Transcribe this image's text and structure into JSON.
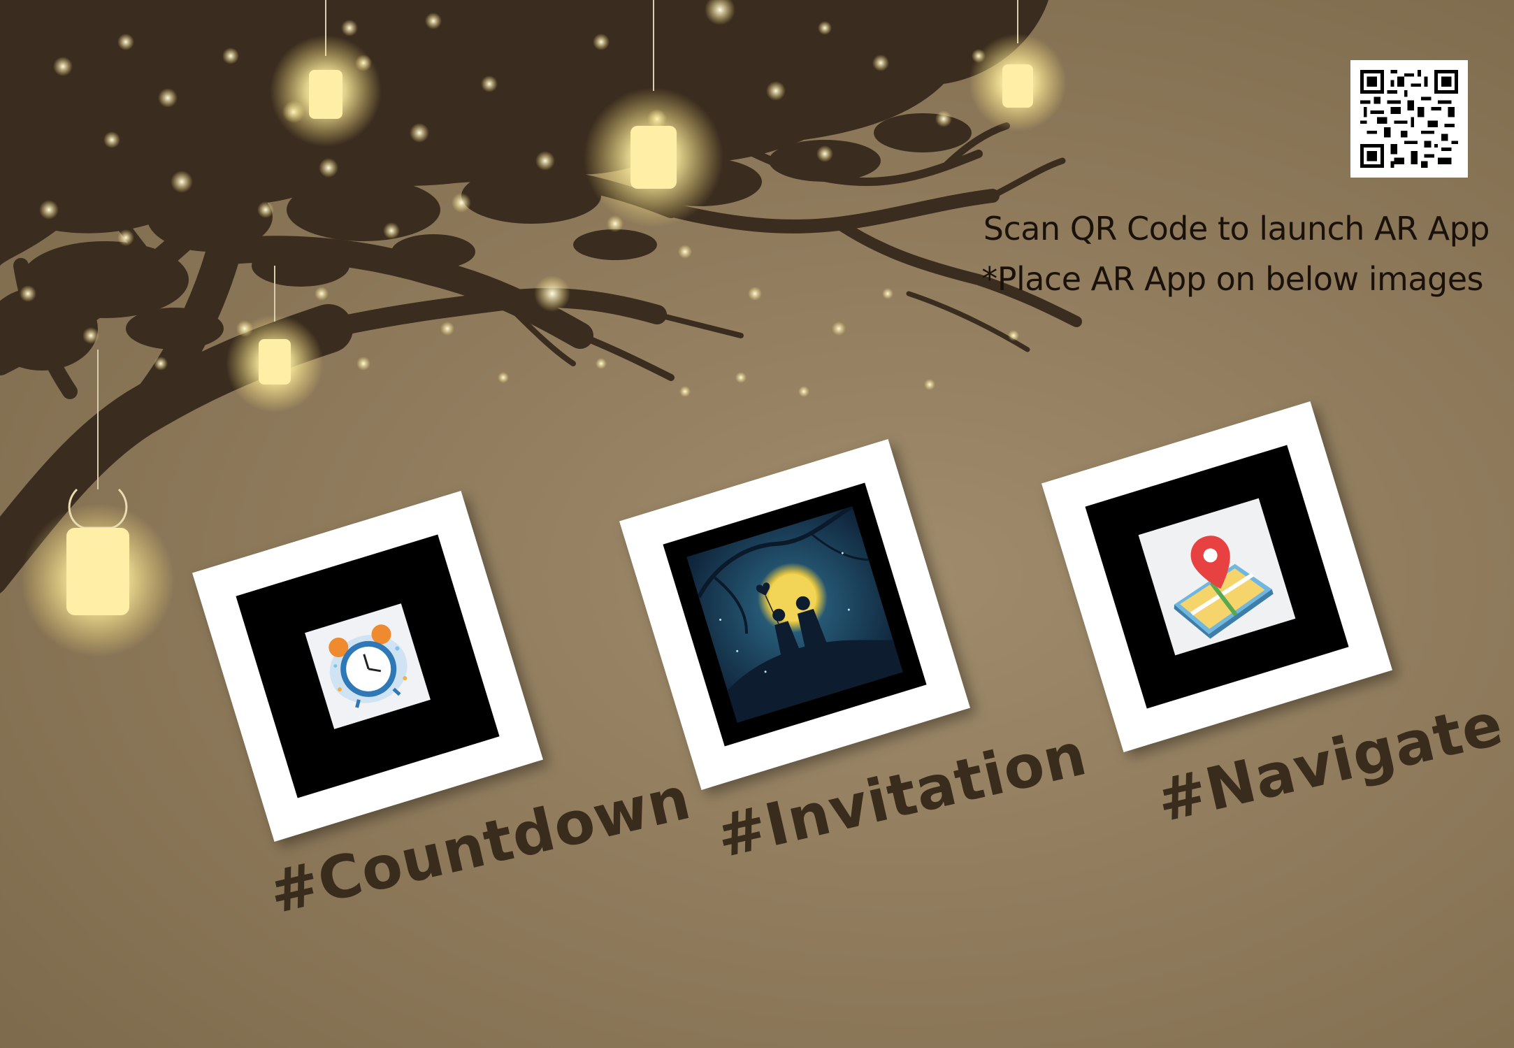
{
  "instructions": {
    "line1": "Scan QR Code to launch AR App",
    "line2": "*Place AR App on below images"
  },
  "markers": [
    {
      "tag": "#Countdown",
      "image": "alarm-clock-icon"
    },
    {
      "tag": "#Invitation",
      "image": "couple-under-moon-illustration"
    },
    {
      "tag": "#Navigate",
      "image": "map-pin-icon"
    }
  ],
  "colors": {
    "background": "#8f7b5c",
    "tree": "#3a2c1f",
    "tag_text": "#3a2c1d",
    "instruction_text": "#1a120a",
    "lantern_glow": "#fff3b0"
  }
}
